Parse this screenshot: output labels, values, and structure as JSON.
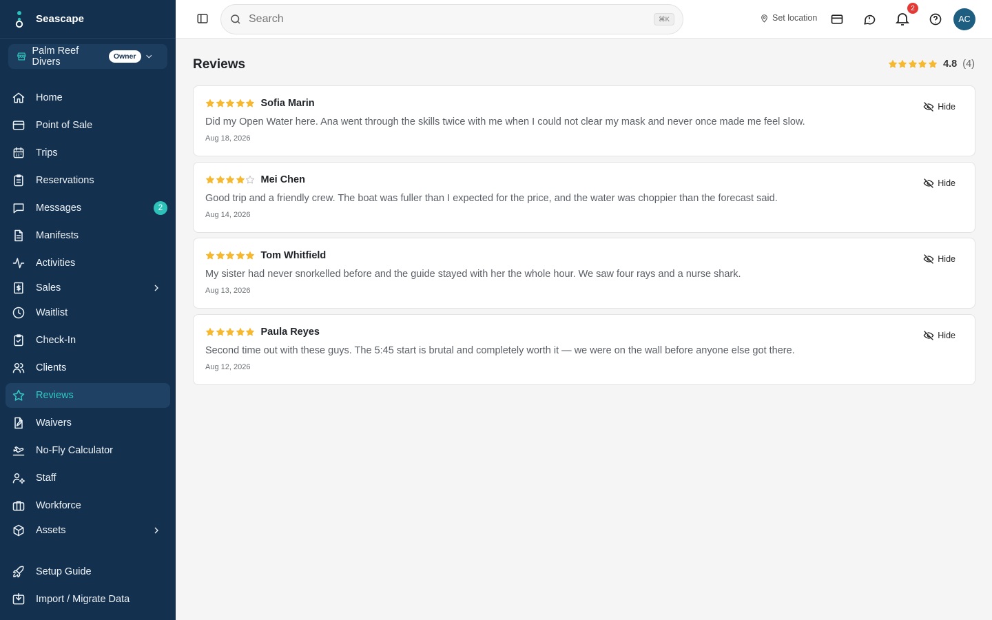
{
  "brand": {
    "name": "Seascape"
  },
  "org": {
    "name": "Palm Reef Divers",
    "role": "Owner"
  },
  "nav": [
    {
      "label": "Home",
      "icon": "home-icon"
    },
    {
      "label": "Point of Sale",
      "icon": "credit-card-icon"
    },
    {
      "label": "Trips",
      "icon": "calendar-icon"
    },
    {
      "label": "Reservations",
      "icon": "clipboard-icon"
    },
    {
      "label": "Messages",
      "icon": "message-icon",
      "badge": "2"
    },
    {
      "label": "Manifests",
      "icon": "document-icon"
    },
    {
      "label": "Activities",
      "icon": "activity-icon"
    },
    {
      "label": "Sales",
      "icon": "receipt-icon",
      "expandable": true
    },
    {
      "label": "Waitlist",
      "icon": "clock-icon"
    },
    {
      "label": "Check-In",
      "icon": "clipboard-check-icon"
    },
    {
      "label": "Clients",
      "icon": "users-icon"
    },
    {
      "label": "Reviews",
      "icon": "star-icon",
      "active": true
    },
    {
      "label": "Waivers",
      "icon": "file-signature-icon"
    },
    {
      "label": "No-Fly Calculator",
      "icon": "plane-icon"
    },
    {
      "label": "Staff",
      "icon": "user-cog-icon"
    },
    {
      "label": "Workforce",
      "icon": "briefcase-icon"
    },
    {
      "label": "Assets",
      "icon": "box-icon",
      "expandable": true
    },
    {
      "label": "Setup Guide",
      "icon": "rocket-icon"
    },
    {
      "label": "Import / Migrate Data",
      "icon": "import-icon"
    }
  ],
  "topbar": {
    "search_placeholder": "Search",
    "search_shortcut": "⌘K",
    "set_location": "Set location",
    "notifications_count": "2",
    "avatar_initials": "AC"
  },
  "page": {
    "title": "Reviews",
    "average": "4.8",
    "count": "(4)",
    "average_stars": 5
  },
  "colors": {
    "star": "#f5b82e",
    "accent": "#2cc2b9",
    "sidebar": "#13314f"
  },
  "reviews": [
    {
      "author": "Sofia Marin",
      "rating": 5,
      "text": "Did my Open Water here. Ana went through the skills twice with me when I could not clear my mask and never once made me feel slow.",
      "date": "Aug 18, 2026",
      "action": "Hide"
    },
    {
      "author": "Mei Chen",
      "rating": 4,
      "text": "Good trip and a friendly crew. The boat was fuller than I expected for the price, and the water was choppier than the forecast said.",
      "date": "Aug 14, 2026",
      "action": "Hide"
    },
    {
      "author": "Tom Whitfield",
      "rating": 5,
      "text": "My sister had never snorkelled before and the guide stayed with her the whole hour. We saw four rays and a nurse shark.",
      "date": "Aug 13, 2026",
      "action": "Hide"
    },
    {
      "author": "Paula Reyes",
      "rating": 5,
      "text": "Second time out with these guys. The 5:45 start is brutal and completely worth it — we were on the wall before anyone else got there.",
      "date": "Aug 12, 2026",
      "action": "Hide"
    }
  ]
}
